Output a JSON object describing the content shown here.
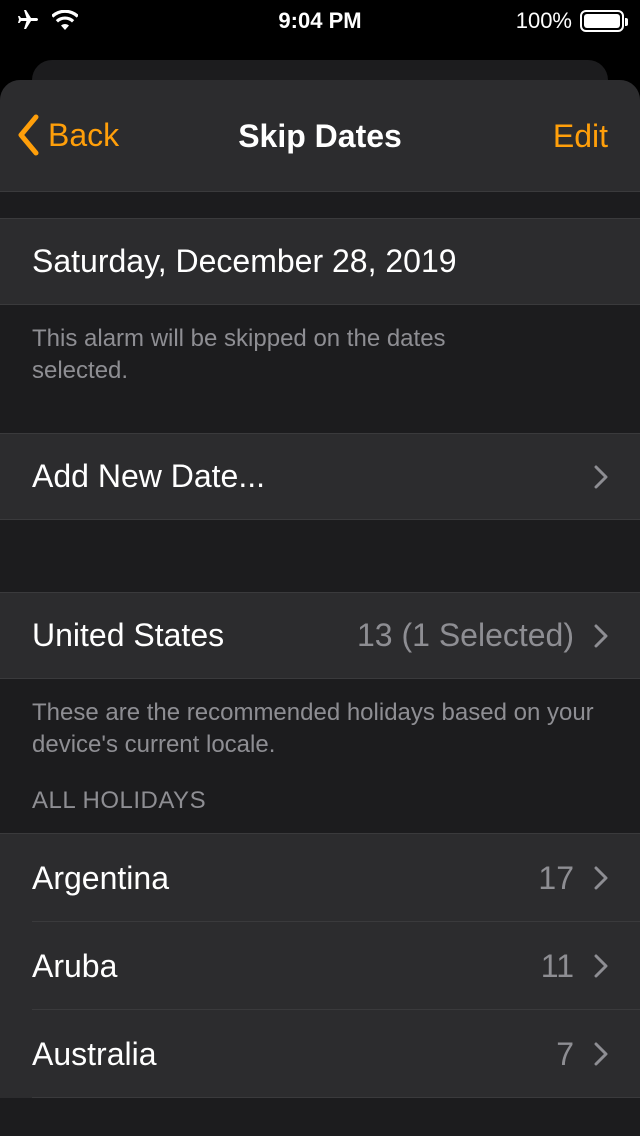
{
  "status_bar": {
    "time": "9:04 PM",
    "battery": "100%",
    "icons": [
      "airplane-icon",
      "wifi-icon",
      "battery-icon"
    ]
  },
  "nav": {
    "back_label": "Back",
    "title": "Skip Dates",
    "edit_label": "Edit"
  },
  "skipped_date": {
    "label": "Saturday, December 28, 2019"
  },
  "skipped_note": "This alarm will be skipped on the dates selected.",
  "add_new": {
    "label": "Add New Date..."
  },
  "locale": {
    "country": "United States",
    "detail": "13 (1 Selected)",
    "note": "These are the recommended holidays based on your device's current locale."
  },
  "all_holidays": {
    "header": "ALL HOLIDAYS",
    "items": [
      {
        "label": "Argentina",
        "count": "17"
      },
      {
        "label": "Aruba",
        "count": "11"
      },
      {
        "label": "Australia",
        "count": "7"
      }
    ]
  },
  "colors": {
    "accent": "#ff9f0a",
    "background": "#1c1c1e",
    "cell": "#2c2c2e",
    "secondary_text": "#8e8e93"
  }
}
